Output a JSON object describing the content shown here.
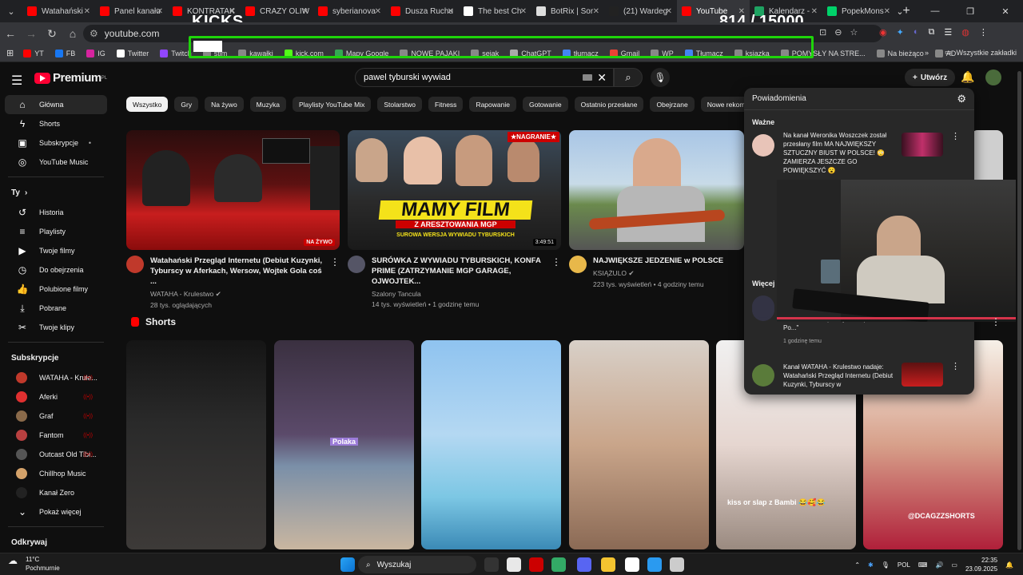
{
  "tabs": [
    {
      "label": "Watahański",
      "color": "#ff0000"
    },
    {
      "label": "Panel kanału",
      "color": "#ff0000"
    },
    {
      "label": "KONTRATAK",
      "color": "#ff0000"
    },
    {
      "label": "CRAZY OLIW",
      "color": "#ff0000"
    },
    {
      "label": "syberianova",
      "color": "#ff0000"
    },
    {
      "label": "Dusza Ruchu",
      "color": "#ff0000"
    },
    {
      "label": "The best Ch",
      "color": "#ffffff"
    },
    {
      "label": "BotRix | Sor",
      "color": "#dddddd"
    },
    {
      "label": "(21) Wardeg",
      "color": "#222222"
    },
    {
      "label": "YouTube",
      "color": "#ff0000"
    },
    {
      "label": "Kalendarz -",
      "color": "#1ea362"
    },
    {
      "label": "PopekMons",
      "color": "#00d26a"
    }
  ],
  "address": {
    "url": "youtube.com"
  },
  "overlay": {
    "title": "KICKS",
    "count": "814",
    "goal": "/ 15000"
  },
  "bookmarks": [
    {
      "label": "YT",
      "color": "#ff0000"
    },
    {
      "label": "FB",
      "color": "#1877f2"
    },
    {
      "label": "IG",
      "color": "#d6249f"
    },
    {
      "label": "Twitter",
      "color": "#ffffff"
    },
    {
      "label": "Twitch",
      "color": "#9146ff"
    },
    {
      "label": "stim",
      "color": "#888"
    },
    {
      "label": "kawałki",
      "color": "#888"
    },
    {
      "label": "kick.com",
      "color": "#53fc18"
    },
    {
      "label": "Mapy Google",
      "color": "#34a853"
    },
    {
      "label": "NOWE PAJAKI",
      "color": "#888"
    },
    {
      "label": "sejak",
      "color": "#888"
    },
    {
      "label": "ChatGPT",
      "color": "#aaa"
    },
    {
      "label": "tłumacz",
      "color": "#4285f4"
    },
    {
      "label": "Gmail",
      "color": "#ea4335"
    },
    {
      "label": "WP",
      "color": "#888"
    },
    {
      "label": "Tłumacz",
      "color": "#4285f4"
    },
    {
      "label": "ksiazka",
      "color": "#888"
    },
    {
      "label": "POMYSŁY NA STRE...",
      "color": "#888"
    },
    {
      "label": "Na bieżąco",
      "color": "#888"
    },
    {
      "label": "AD",
      "color": "#888"
    }
  ],
  "bookmarks_all": "Wszystkie zakładki",
  "header": {
    "logo": "Premium",
    "logo_sup": "PL",
    "search_value": "pawel tyburski wywiad",
    "create": "Utwórz"
  },
  "sidebar": {
    "main": [
      {
        "label": "Główna",
        "icon": "home-icon"
      },
      {
        "label": "Shorts",
        "icon": "shorts-icon"
      },
      {
        "label": "Subskrypcje",
        "icon": "subscriptions-icon"
      },
      {
        "label": "YouTube Music",
        "icon": "music-icon"
      }
    ],
    "you_title": "Ty",
    "you": [
      {
        "label": "Historia"
      },
      {
        "label": "Playlisty"
      },
      {
        "label": "Twoje filmy"
      },
      {
        "label": "Do obejrzenia"
      },
      {
        "label": "Polubione filmy"
      },
      {
        "label": "Pobrane"
      },
      {
        "label": "Twoje klipy"
      }
    ],
    "subs_title": "Subskrypcje",
    "subs": [
      {
        "label": "WATAHA - Krule...",
        "color": "#c0392b"
      },
      {
        "label": "Aferki",
        "color": "#e03030"
      },
      {
        "label": "Graf",
        "color": "#8a6a4a"
      },
      {
        "label": "Fantom",
        "color": "#b84040"
      },
      {
        "label": "Outcast Old Tibi...",
        "color": "#555"
      },
      {
        "label": "Chillhop Music",
        "color": "#d4a26a"
      },
      {
        "label": "Kanał Zero",
        "color": "#222"
      }
    ],
    "more": "Pokaż więcej",
    "explore": "Odkrywaj"
  },
  "chips": [
    "Wszystko",
    "Gry",
    "Na żywo",
    "Muzyka",
    "Playlisty YouTube Mix",
    "Stolarstwo",
    "Fitness",
    "Rapowanie",
    "Gotowanie",
    "Ostatnio przesłane",
    "Obejrzane",
    "Nowe rekomenda"
  ],
  "videos": [
    {
      "title": "Watahański Przegląd Internetu (Debiut Kuzynki, Tyburscy w Aferkach, Wersow, Wojtek Gola coś ...",
      "channel": "WATAHA - Krulestwo",
      "stats": "28 tys. oglądających",
      "badge": "NA ŻYWO"
    },
    {
      "title": "SURÓWKA Z WYWIADU TYBURSKICH, KONFA PRIME (ZATRZYMANIE MGP GARAGE, OJWOJTEK...",
      "channel": "Szalony Tancula",
      "stats": "14 tys. wyświetleń • 1 godzinę temu",
      "duration": "3:49:51",
      "banner": "MAMY FILM",
      "banner2": "Z ARESZTOWANIA MGP",
      "banner3": "SUROWA WERSJA WYWIADU TYBURSKICH",
      "tag": "NAGRANIE"
    },
    {
      "title": "NAJWIĘKSZE JEDZENIE w POLSCE",
      "channel": "KSIĄŻULO",
      "stats": "223 tys. wyświetleń • 4 godziny temu"
    }
  ],
  "shorts_title": "Shorts",
  "shorts": [
    {
      "caption": ""
    },
    {
      "caption": "Polaka"
    },
    {
      "caption": ""
    },
    {
      "caption": ""
    },
    {
      "caption": "kiss or slap z Bambi 😂🥰😂"
    },
    {
      "caption": "@DCAGZZSHORTS"
    }
  ],
  "notifications": {
    "title": "Powiadomienia",
    "important": "Ważne",
    "more": "Więcej p",
    "items": [
      {
        "text": "Na kanał Weronika Woszczek został przesłany film MA NAJWIĘKSZY SZTUCZNY BIUST W POLSCE! 😳 ZAMIERZA JESZCZE GO POWIĘKSZYĆ 😮"
      },
      {
        "text": "twierdzi, że nie podwyższali podatków? Po...\"",
        "time": "1 godzinę temu"
      },
      {
        "text": "Kanał WATAHA - Krulestwo nadaje: Watahański Przegląd Internetu (Debiut Kuzynki, Tyburscy w"
      }
    ]
  },
  "taskbar": {
    "temp": "11°C",
    "weather": "Pochmurnie",
    "search": "Wyszukaj",
    "lang": "POL",
    "time": "22:35",
    "date": "23.09.2025"
  }
}
